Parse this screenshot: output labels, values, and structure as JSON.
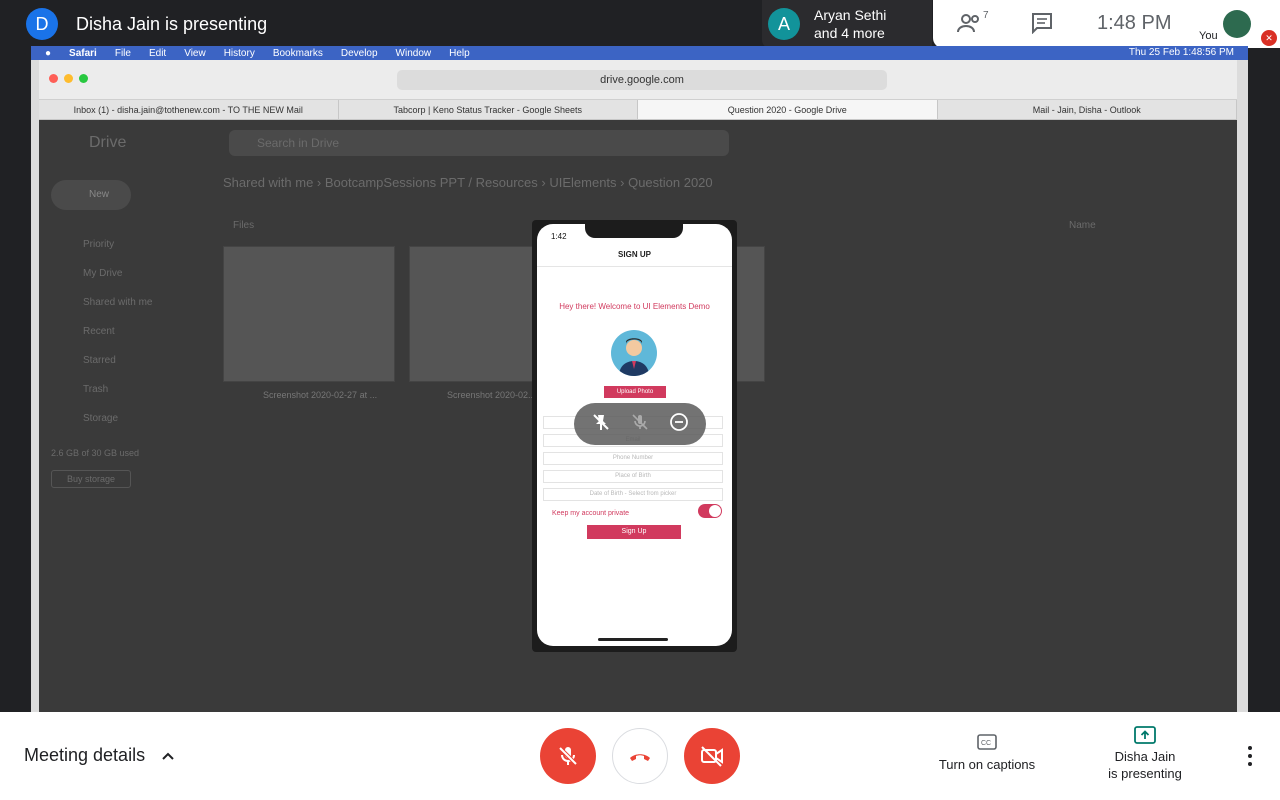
{
  "presenter": {
    "avatar_letter": "D",
    "text": "Disha Jain is presenting"
  },
  "others": {
    "avatar_letter": "A",
    "line1": "Aryan Sethi",
    "line2": "and 4 more"
  },
  "top_panel": {
    "people_count": "7",
    "time": "1:48 PM",
    "you_label": "You"
  },
  "mac_menu": {
    "items": [
      "Safari",
      "File",
      "Edit",
      "View",
      "History",
      "Bookmarks",
      "Develop",
      "Window",
      "Help"
    ],
    "datetime": "Thu 25 Feb  1:48:56 PM"
  },
  "safari": {
    "url": "drive.google.com",
    "tabs": [
      "Inbox (1) - disha.jain@tothenew.com - TO THE NEW Mail",
      "Tabcorp | Keno Status Tracker - Google Sheets",
      "Question 2020 - Google Drive",
      "Mail - Jain, Disha - Outlook"
    ]
  },
  "drive": {
    "logo": "Drive",
    "search_placeholder": "Search in Drive",
    "breadcrumb": "Shared with me  ›  BootcampSessions PPT / Resources  ›  UIElements  ›  Question 2020",
    "new_label": "New",
    "sidebar": [
      "Priority",
      "My Drive",
      "Shared with me",
      "Recent",
      "Starred",
      "Trash",
      "Storage"
    ],
    "storage_text": "2.6 GB of 30 GB used",
    "buy_storage": "Buy storage",
    "files_label": "Files",
    "name_label": "Name",
    "thumbs": [
      {
        "name": "Screenshot 2020-02-27 at ..."
      },
      {
        "name": "Screenshot 2020-02..."
      }
    ]
  },
  "phone": {
    "time": "1:42",
    "title": "SIGN UP",
    "welcome": "Hey there! Welcome to UI Elements Demo",
    "upload_label": "Upload Photo",
    "fields": [
      "",
      "Email",
      "Phone Number",
      "Place of Birth",
      "Date of Birth - Select from picker"
    ],
    "private_label": "Keep my account private",
    "signup_label": "Sign Up"
  },
  "bottom": {
    "meeting_details": "Meeting details",
    "captions": "Turn on captions",
    "presenting_line1": "Disha Jain",
    "presenting_line2": "is presenting"
  },
  "colors": {
    "accent_red": "#ea4335",
    "phone_pink": "#d13a5e",
    "meet_blue": "#1a73e8"
  }
}
